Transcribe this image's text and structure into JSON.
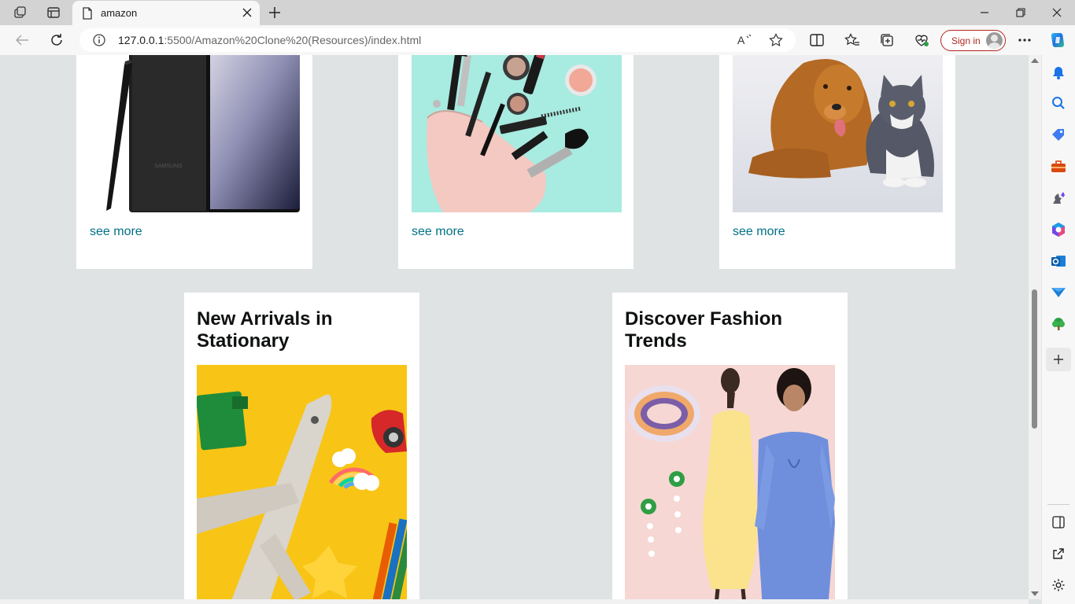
{
  "browser": {
    "tab_title": "amazon",
    "url_host": "127.0.0.1",
    "url_rest": ":5500/Amazon%20Clone%20(Resources)/index.html",
    "signin_label": "Sign in",
    "accent": "#b3261e"
  },
  "page": {
    "link_color": "#007185",
    "top_cards": [
      {
        "image": "smartphone",
        "link": "see more"
      },
      {
        "image": "cosmetics-bag",
        "link": "see more"
      },
      {
        "image": "dog-and-cat",
        "link": "see more"
      }
    ],
    "bottom_cards": [
      {
        "title": "New Arrivals in Stationary",
        "image": "toy-airplane-and-pencils"
      },
      {
        "title": "Discover Fashion Trends",
        "image": "fashion-models"
      }
    ]
  }
}
